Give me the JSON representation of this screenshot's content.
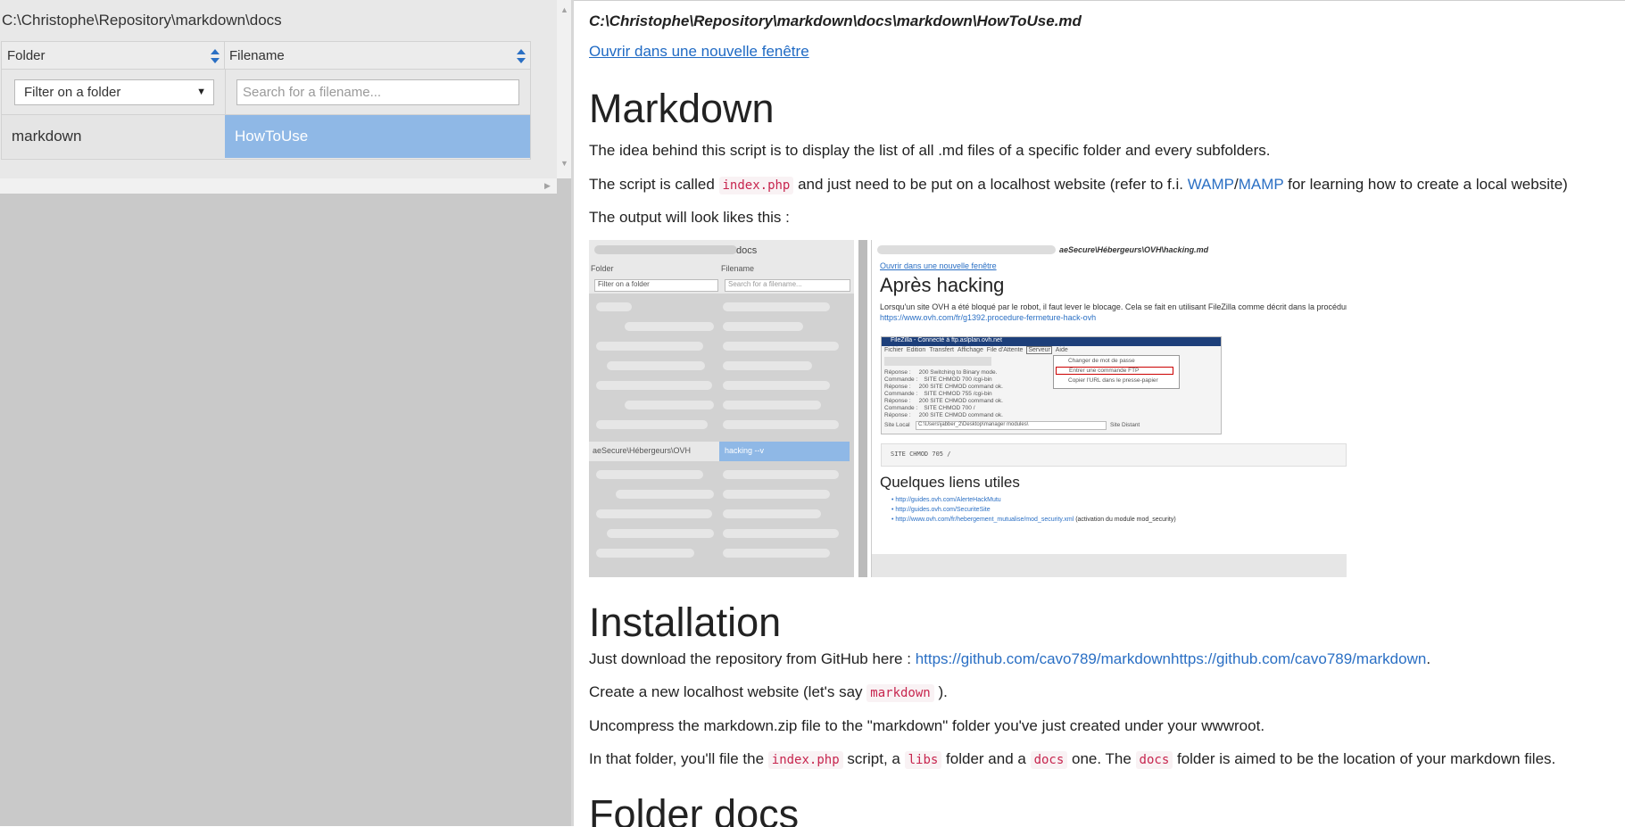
{
  "left_panel": {
    "path_title": "C:\\Christophe\\Repository\\markdown\\docs",
    "columns": {
      "folder": "Folder",
      "filename": "Filename"
    },
    "folder_filter": {
      "selected": "Filter on a folder"
    },
    "filename_search": {
      "placeholder": "Search for a filename..."
    },
    "rows": [
      {
        "folder": "markdown",
        "filename": "HowToUse",
        "selected": true
      }
    ]
  },
  "content": {
    "file_path": "C:\\Christophe\\Repository\\markdown\\docs\\markdown\\HowToUse.md",
    "open_link": "Ouvrir dans une nouvelle fenêtre",
    "h_markdown": "Markdown",
    "p1": "The idea behind this script is to display the list of all .md files of a specific folder and every subfolders.",
    "p2": {
      "before": "The script is called ",
      "code": "index.php",
      "middle": " and just need to be put on a localhost website (refer to f.i. ",
      "link_wamp": "WAMP",
      "slash": "/",
      "link_mamp": "MAMP",
      "after": " for learning how to create a local website)"
    },
    "p3": "The output will look likes this :",
    "thumbnail": {
      "path": "docs",
      "folder_header": "Folder",
      "filename_header": "Filename",
      "filter": "Filter on a folder",
      "search": "Search for a filename...",
      "selected_folder": "aeSecure\\Hébergeurs\\OVH",
      "selected_file": "hacking --v",
      "right_path": "aeSecure\\Hébergeurs\\OVH\\hacking.md",
      "open_link": "Ouvrir dans une nouvelle fenêtre",
      "h1": "Après hacking",
      "p": "Lorsqu'un site OVH a été bloqué par le robot, il faut lever le blocage. Cela se fait en utilisant FileZilla comme décrit dans la procédure",
      "p_link": "https://www.ovh.com/fr/g1392.procedure-fermeture-hack-ovh",
      "fz_title": "FileZilla - Connecté à ftp.aslplan.ovh.net",
      "fz_menu": [
        "Fichier",
        "Edition",
        "Transfert",
        "Affichage",
        "File d'Attente",
        "Serveur",
        "Aide"
      ],
      "fz_popup": [
        "Changer de mot de passe",
        "Entrer une commande FTP",
        "Copier l'URL dans le presse-papier"
      ],
      "fz_log": [
        "Réponse :     200 Switching to Binary mode.",
        "Commande :    SITE CHMOD 700 /cgi-bin",
        "Réponse :     200 SITE CHMOD command ok.",
        "Commande :    SITE CHMOD 755 /cgi-bin",
        "Réponse :     200 SITE CHMOD command ok.",
        "Commande :    SITE CHMOD 700 /",
        "Réponse :     200 SITE CHMOD command ok."
      ],
      "fz_local": "Site Local",
      "fz_local_path": "C:\\Users\\jabber_2\\Desktop\\manager modules\\",
      "fz_remote": "Site Distant",
      "code": "SITE CHMOD 705 /",
      "h2": "Quelques liens utiles",
      "links": [
        "http://guides.ovh.com/AlerteHackMutu",
        "http://guides.ovh.com/SecuriteSite",
        "http://www.ovh.com/fr/hebergement_mutualise/mod_security.xml"
      ],
      "links_suffix": "(activation du module mod_security)"
    },
    "h_install": "Installation",
    "p4": {
      "before": "Just download the repository from GitHub here : ",
      "link": "https://github.com/cavo789/markdownhttps://github.com/cavo789/markdown",
      "after": "."
    },
    "p5": {
      "before": "Create a new localhost website (let's say ",
      "code": "markdown",
      "after": " )."
    },
    "p6": "Uncompress the markdown.zip file to the \"markdown\" folder you've just created under your wwwroot.",
    "p7": {
      "a": "In that folder, you'll file the ",
      "code1": "index.php",
      "b": " script, a ",
      "code2": "libs",
      "c": " folder and a ",
      "code3": "docs",
      "d": " one. The ",
      "code4": "docs",
      "e": " folder is aimed to be the location of your markdown files."
    },
    "h_folder": "Folder docs"
  },
  "colors": {
    "selected_row": "#8fb8e6",
    "link": "#2a6fc4",
    "code": "#c7254e",
    "panel_bg": "#c9c9c9"
  }
}
